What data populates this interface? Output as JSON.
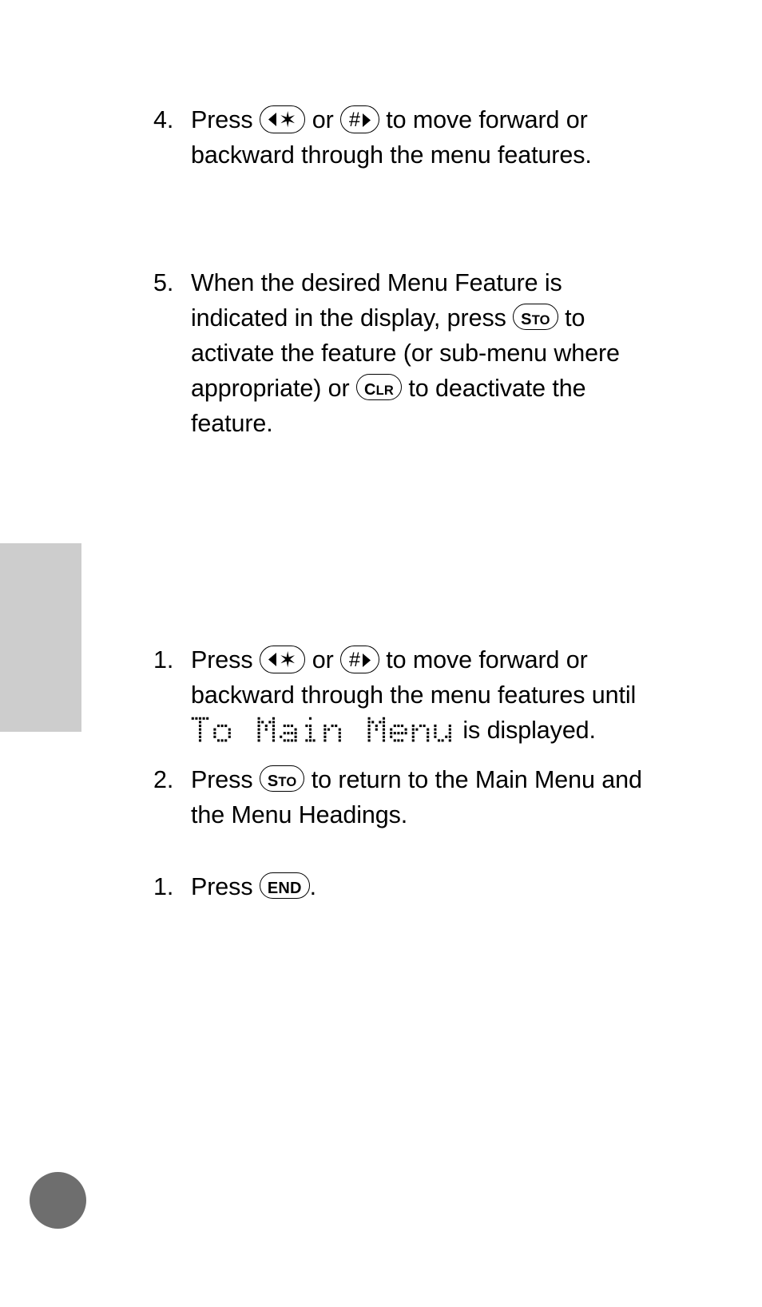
{
  "page": {
    "background_color": "#ffffff",
    "text_color": "#000000",
    "edge_tab_color": "#cdcdcd",
    "corner_dot_color": "#6e6e6e"
  },
  "keys": {
    "sto": {
      "label": "STO",
      "cap": "S",
      "rest": "TO"
    },
    "clr": {
      "label": "CLR",
      "cap": "C",
      "rest": "LR"
    },
    "end": {
      "label": "END"
    },
    "star_back": {
      "label": "*",
      "glyph": "✶",
      "arrow": "left",
      "name": "star-back-key"
    },
    "hash_fwd": {
      "label": "#",
      "glyph": "#",
      "arrow": "right",
      "name": "hash-forward-key"
    }
  },
  "lcd": {
    "to_main_menu": "To Main Menu"
  },
  "steps": [
    {
      "number": "4.",
      "t1": "Press ",
      "t2": " or ",
      "t3": " to move forward or backward through the menu features."
    },
    {
      "number": "5.",
      "t1": "When the desired Menu Feature is indicated in the display, press ",
      "t2": " to activate the feature (or sub-menu where appropriate) or ",
      "t3": " to deactivate the feature."
    },
    {
      "number": "1.",
      "t1": "Press ",
      "t2": " or ",
      "t3": " to move forward or backward through the menu features until ",
      "t4": " is displayed."
    },
    {
      "number": "2.",
      "t1": "Press ",
      "t2": " to return to the Main Menu and the Menu Headings."
    },
    {
      "number": "1.",
      "t1": "Press ",
      "t2": "."
    }
  ]
}
